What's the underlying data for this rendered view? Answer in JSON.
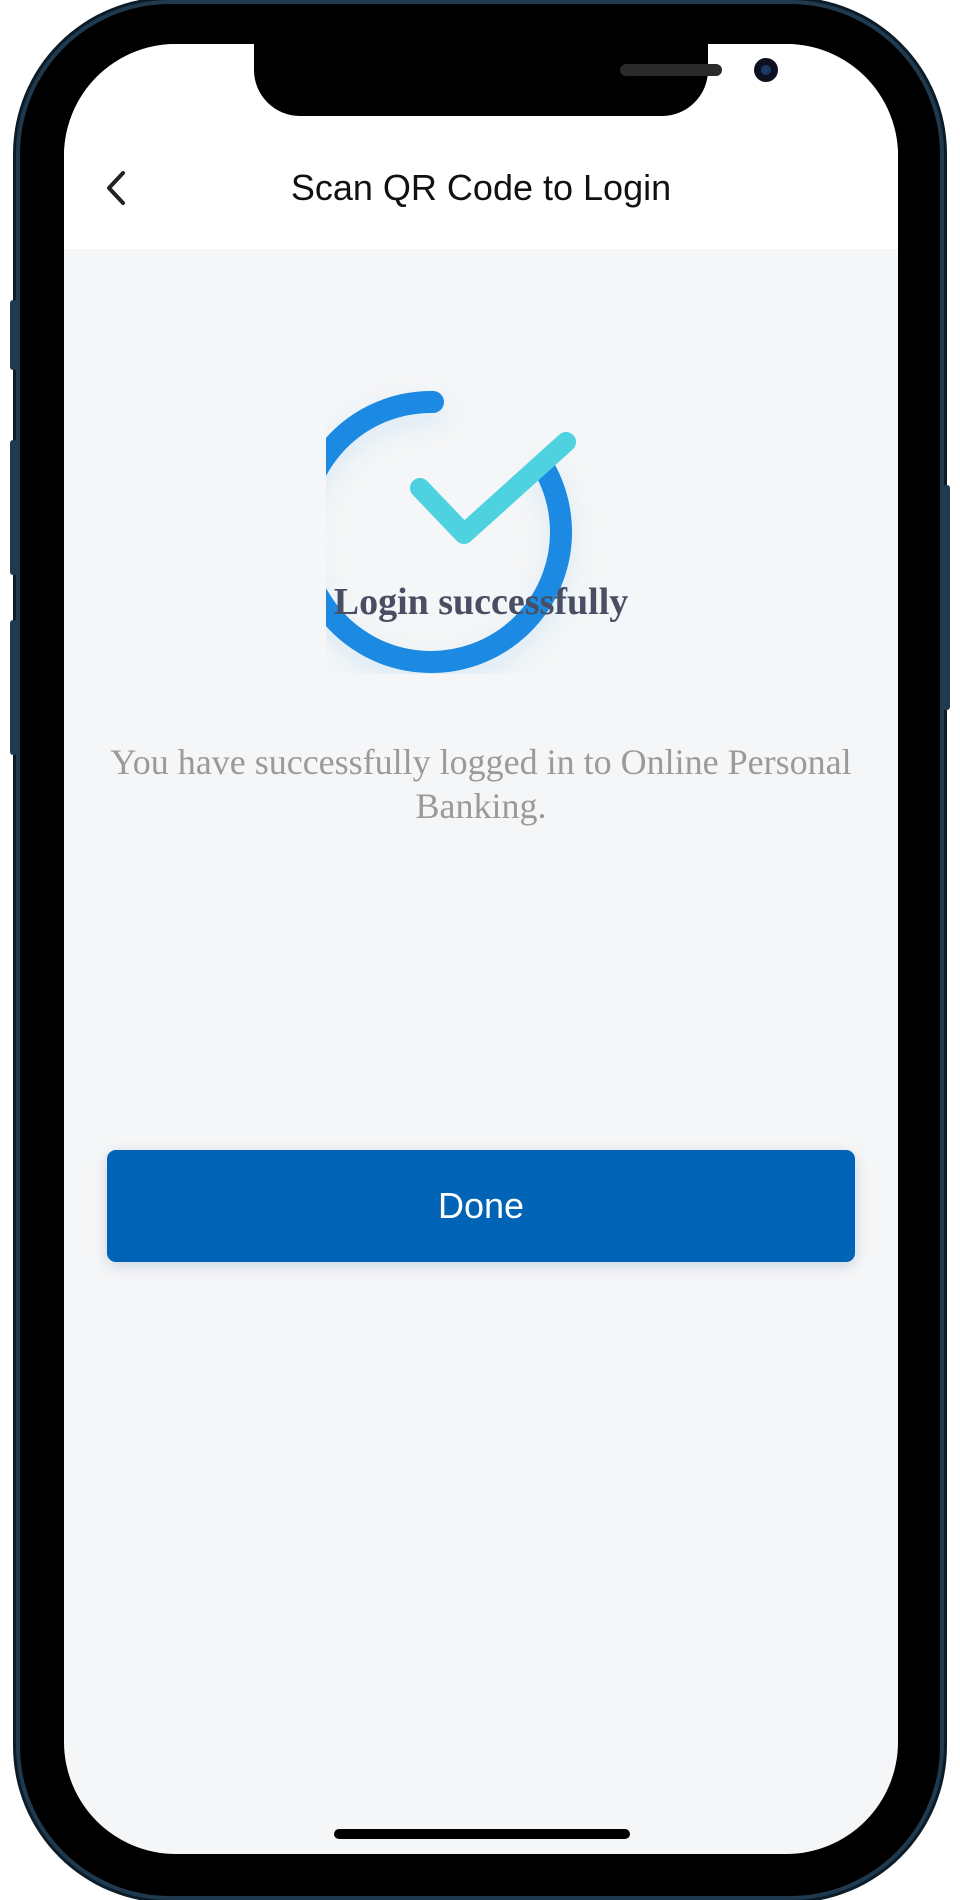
{
  "header": {
    "title": "Scan QR Code to Login",
    "back_icon": "chevron-left-icon"
  },
  "result": {
    "icon": "checkmark-circle-icon",
    "title": "Login successfully",
    "message": "You have successfully logged in to Online Personal Banking."
  },
  "actions": {
    "done_label": "Done"
  },
  "colors": {
    "primary": "#0063b6",
    "ring": "#1a8ae3",
    "check": "#4ed2e0",
    "title_text": "#4a4e63",
    "message_text": "#9a9a9a",
    "background": "#f5f6f7"
  }
}
